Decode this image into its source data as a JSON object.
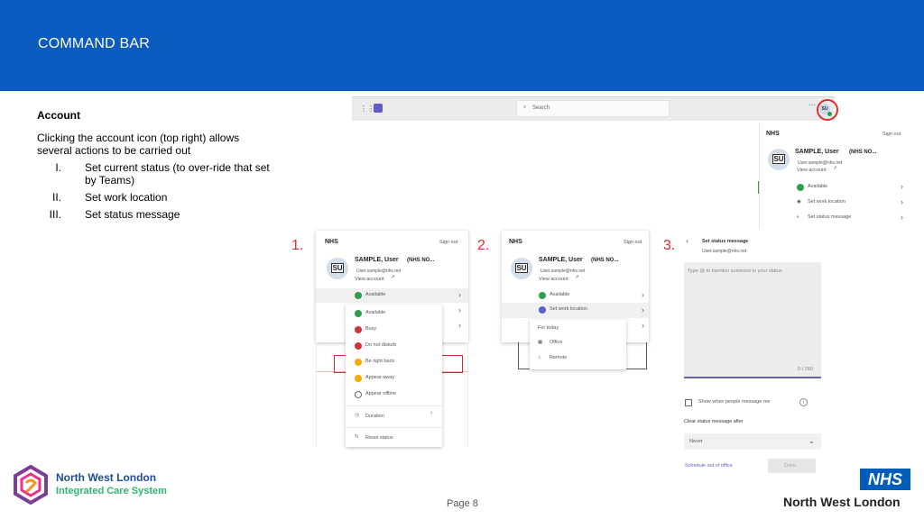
{
  "header": {
    "title": "COMMAND BAR"
  },
  "left": {
    "heading": "Account",
    "intro": "Clicking the account icon (top right) allows several actions to be carried out",
    "items": [
      {
        "num": "I.",
        "text": "Set current status (to over-ride that set by Teams)"
      },
      {
        "num": "II.",
        "text": "Set work location"
      },
      {
        "num": "III.",
        "text": "Set status message"
      }
    ]
  },
  "teams_bar": {
    "search": "Search",
    "avatar": "SU"
  },
  "account_card": {
    "org": "NHS",
    "sign_out": "Sign out",
    "name": "SAMPLE, User",
    "org_tag": "(NHS NO...",
    "email": "User.sample@nhs.net",
    "view_account": "View account",
    "initials": "SU",
    "status": "Available",
    "location": "Set work location",
    "status_msg": "Set status message"
  },
  "step_labels": [
    "1.",
    "2.",
    "3."
  ],
  "status_menu": [
    "Available",
    "Busy",
    "Do not disturb",
    "Be right back",
    "Appear away",
    "Appear offline",
    "Duration",
    "Reset status"
  ],
  "location_menu": {
    "header": "For today",
    "items": [
      "Office",
      "Remote"
    ]
  },
  "status_message": {
    "title": "Set status message",
    "email": "User.sample@nhs.net",
    "placeholder": "Type @ to mention someone in your status",
    "counter": "0 / 280",
    "show_when": "Show when people message me",
    "clear_after": "Clear status message after",
    "never": "Never",
    "schedule": "Schedule out of office",
    "done": "Done"
  },
  "footer": {
    "org_line1": "North West London",
    "org_line2": "Integrated Care System",
    "page": "Page 8",
    "nhs": "NHS",
    "nhs_region": "North West London"
  },
  "colors": {
    "header": "#0b5bbf",
    "accent_red": "#e52b2b",
    "available": "#2e9d4e",
    "nhs_blue": "#005eb8"
  }
}
